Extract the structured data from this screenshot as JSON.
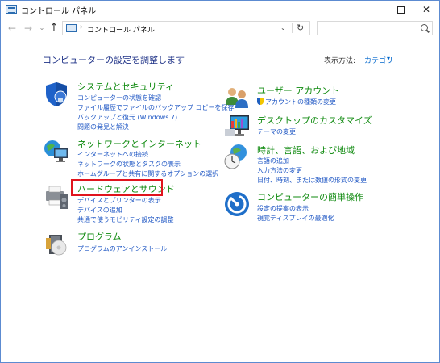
{
  "window": {
    "title": "コントロール パネル",
    "min_glyph": "—",
    "close_glyph": "✕"
  },
  "nav": {
    "back_glyph": "←",
    "forward_glyph": "→",
    "recent_glyph": "⌄",
    "up_glyph": "↑",
    "breadcrumb_sep": "›",
    "address": "コントロール パネル",
    "address_sep_end": "›",
    "dropdown_glyph": "⌄",
    "refresh_glyph": "↻",
    "search_placeholder": ""
  },
  "heading": "コンピューターの設定を調整します",
  "view_by": {
    "label": "表示方法:",
    "value": "カテゴリ",
    "arrow": "▾"
  },
  "categories": {
    "system": {
      "title": "システムとセキュリティ",
      "links": [
        "コンピューターの状態を確認",
        "ファイル履歴でファイルのバックアップ コピーを保存",
        "バックアップと復元 (Windows 7)",
        "問題の発見と解決"
      ]
    },
    "network": {
      "title": "ネットワークとインターネット",
      "links": [
        "インターネットへの接続",
        "ネットワークの状態とタスクの表示",
        "ホームグループと共有に関するオプションの選択"
      ]
    },
    "hardware": {
      "title": "ハードウェアとサウンド",
      "links": [
        "デバイスとプリンターの表示",
        "デバイスの追加",
        "共通で使うモビリティ設定の調整"
      ]
    },
    "programs": {
      "title": "プログラム",
      "links": [
        "プログラムのアンインストール"
      ]
    },
    "users": {
      "title": "ユーザー アカウント",
      "links": [
        "アカウントの種類の変更"
      ]
    },
    "desktop": {
      "title": "デスクトップのカスタマイズ",
      "links": [
        "テーマの変更"
      ]
    },
    "clock": {
      "title": "時計、言語、および地域",
      "links": [
        "言語の追加",
        "入力方法の変更",
        "日付、時刻、または数値の形式の変更"
      ]
    },
    "ease": {
      "title": "コンピューターの簡単操作",
      "links": [
        "設定の提案の表示",
        "視覚ディスプレイの最適化"
      ]
    }
  }
}
